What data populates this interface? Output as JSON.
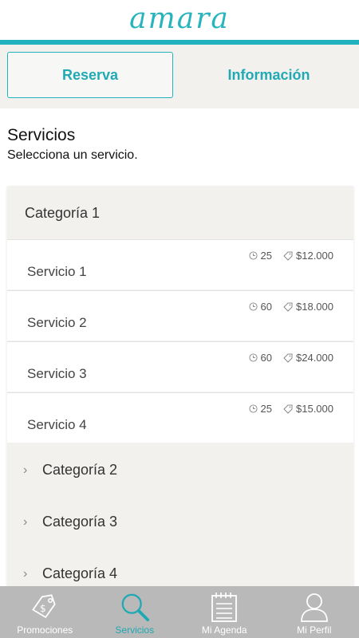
{
  "app": {
    "logo_text": "amara",
    "accent_color": "#21b3bd"
  },
  "tabs": [
    {
      "label": "Reserva",
      "active": true
    },
    {
      "label": "Información",
      "active": false
    }
  ],
  "main": {
    "title": "Servicios",
    "subtitle": "Selecciona un servicio."
  },
  "categories": [
    {
      "label": "Categoría 1",
      "expanded": true,
      "services": [
        {
          "name": "Servicio 1",
          "duration": "25",
          "price": "$12.000"
        },
        {
          "name": "Servicio 2",
          "duration": "60",
          "price": "$18.000"
        },
        {
          "name": "Servicio 3",
          "duration": "60",
          "price": "$24.000"
        },
        {
          "name": "Servicio 4",
          "duration": "25",
          "price": "$15.000"
        }
      ]
    },
    {
      "label": "Categoría 2",
      "expanded": false
    },
    {
      "label": "Categoría 3",
      "expanded": false
    },
    {
      "label": "Categoría 4",
      "expanded": false
    }
  ],
  "bottom_nav": [
    {
      "label": "Promociones",
      "icon": "price-tag-icon",
      "active": false
    },
    {
      "label": "Servicios",
      "icon": "search-icon",
      "active": true
    },
    {
      "label": "Mi Agenda",
      "icon": "notepad-icon",
      "active": false
    },
    {
      "label": "Mi Perfil",
      "icon": "person-icon",
      "active": false
    }
  ]
}
